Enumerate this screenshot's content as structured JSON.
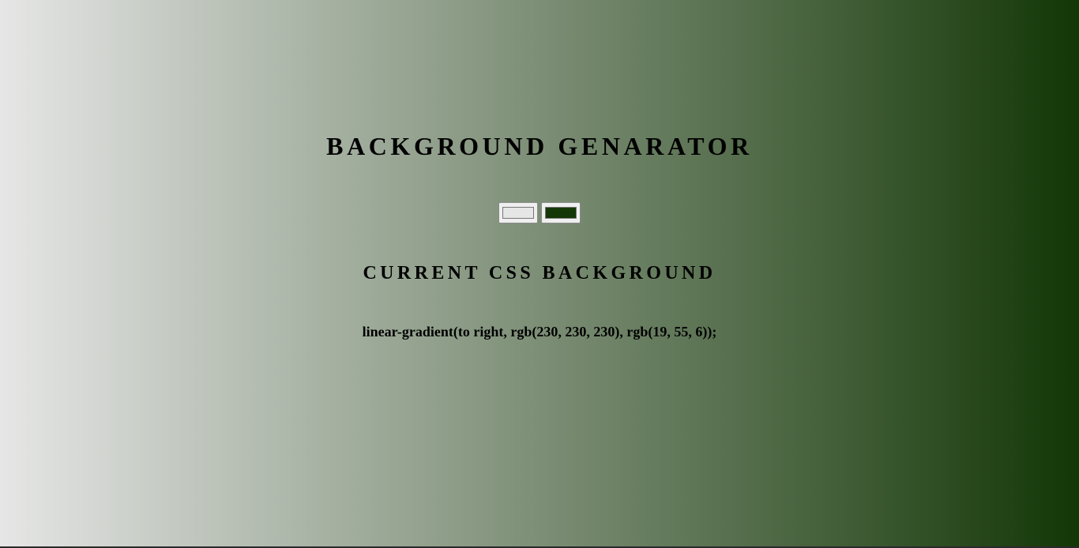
{
  "page": {
    "title": "BACKGROUND GENARATOR",
    "subtitle": "CURRENT CSS BACKGROUND",
    "css_output": "linear-gradient(to right, rgb(230, 230, 230), rgb(19, 55, 6));"
  },
  "colors": {
    "color1": "#e6e6e6",
    "color2": "#133706",
    "text": "#000000"
  },
  "inputs": {
    "color1_value": "#e6e6e6",
    "color2_value": "#133706"
  }
}
